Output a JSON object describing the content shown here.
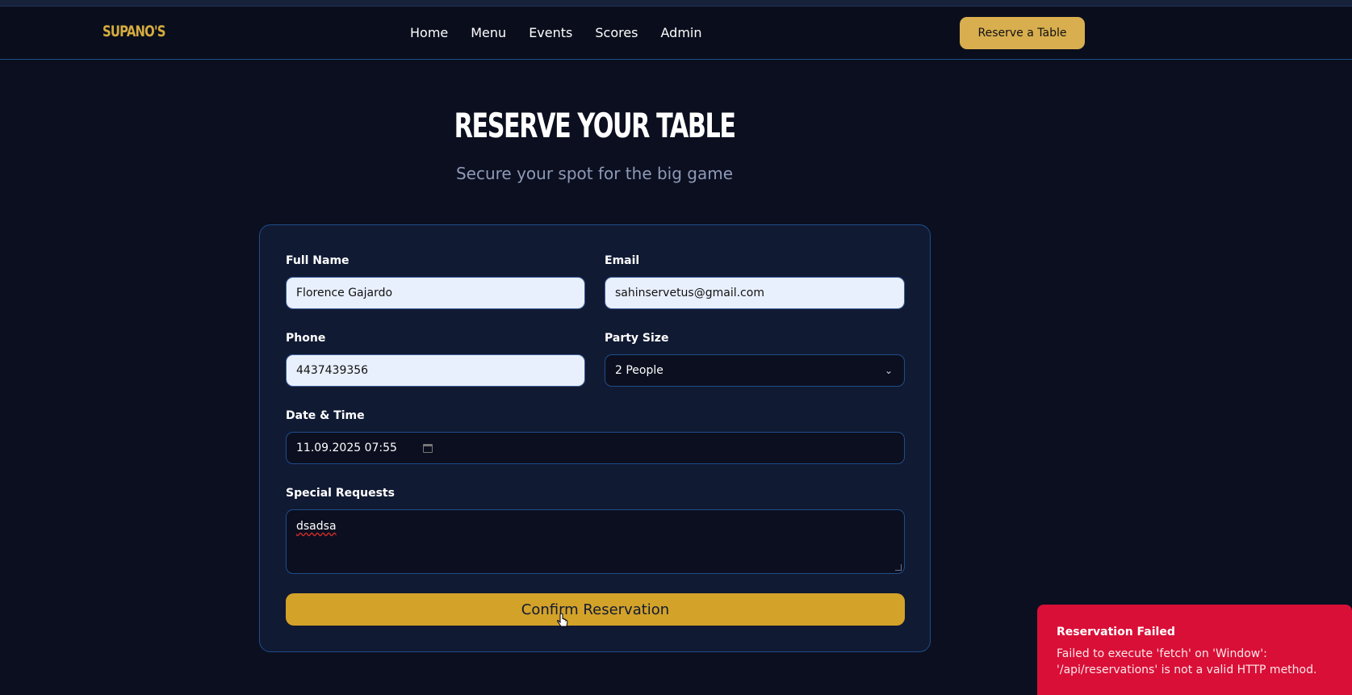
{
  "nav": {
    "logo": "SUPANO'S",
    "links": [
      "Home",
      "Menu",
      "Events",
      "Scores",
      "Admin"
    ],
    "cta": "Reserve a Table"
  },
  "header": {
    "title": "RESERVE YOUR TABLE",
    "subtitle": "Secure your spot for the big game"
  },
  "form": {
    "full_name_label": "Full Name",
    "full_name_value": "Florence Gajardo",
    "email_label": "Email",
    "email_value": "sahinservetus@gmail.com",
    "phone_label": "Phone",
    "phone_value": "4437439356",
    "party_label": "Party Size",
    "party_value": "2 People",
    "datetime_label": "Date & Time",
    "datetime_value": "11.09.2025 07:55",
    "requests_label": "Special Requests",
    "requests_value": "dsadsa",
    "submit_label": "Confirm Reservation"
  },
  "toast": {
    "title": "Reservation Failed",
    "message": "Failed to execute 'fetch' on 'Window': '/api/reservations' is not a valid HTTP method."
  },
  "colors": {
    "background": "#0b0f1f",
    "card": "#111a33",
    "accent": "#d3a228",
    "error": "#d90f37"
  }
}
